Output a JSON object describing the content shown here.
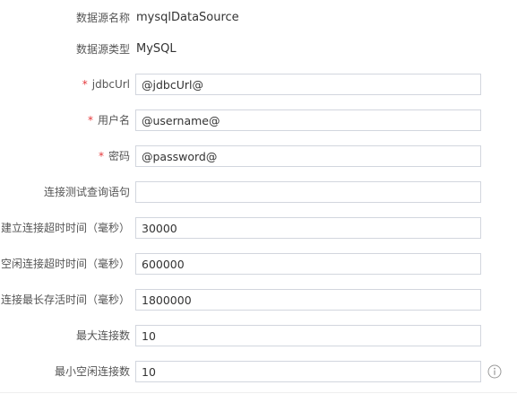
{
  "form": {
    "datasource_name": {
      "label": "数据源名称",
      "value": "mysqlDataSource"
    },
    "datasource_type": {
      "label": "数据源类型",
      "value": "MySQL"
    },
    "required_mark": "*",
    "jdbc_url": {
      "label": "jdbcUrl",
      "value": "@jdbcUrl@",
      "required": true
    },
    "username": {
      "label": "用户名",
      "value": "@username@",
      "required": true
    },
    "password": {
      "label": "密码",
      "value": "@password@",
      "required": true
    },
    "test_query": {
      "label": "连接测试查询语句",
      "value": ""
    },
    "connection_timeout": {
      "label": "建立连接超时时间（毫秒）",
      "value": "30000"
    },
    "idle_timeout": {
      "label": "空闲连接超时时间（毫秒）",
      "value": "600000"
    },
    "max_lifetime": {
      "label": "连接最长存活时间（毫秒）",
      "value": "1800000"
    },
    "max_pool_size": {
      "label": "最大连接数",
      "value": "10"
    },
    "min_idle": {
      "label": "最小空闲连接数",
      "value": "10",
      "help_icon": "info-circle-icon"
    }
  },
  "colors": {
    "required": "#e5383b",
    "label": "#555555",
    "border": "#d2d6de",
    "icon": "#999999"
  }
}
